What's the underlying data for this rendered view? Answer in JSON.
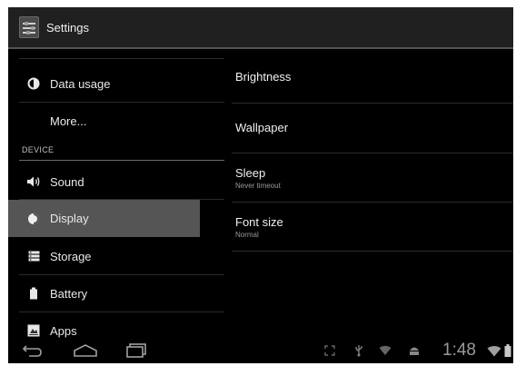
{
  "actionbar": {
    "title": "Settings",
    "icon": "settings-sliders-icon"
  },
  "left": {
    "items_top": [
      {
        "label": "Data usage",
        "icon": "data-usage-icon"
      },
      {
        "label": "More...",
        "icon": ""
      }
    ],
    "section_device": "DEVICE",
    "items_device": [
      {
        "label": "Sound",
        "icon": "speaker-icon"
      },
      {
        "label": "Display",
        "icon": "brightness-icon",
        "selected": true
      },
      {
        "label": "Storage",
        "icon": "storage-icon"
      },
      {
        "label": "Battery",
        "icon": "battery-icon"
      },
      {
        "label": "Apps",
        "icon": "apps-icon"
      }
    ]
  },
  "right": {
    "items": [
      {
        "title": "Brightness",
        "summary": ""
      },
      {
        "title": "Wallpaper",
        "summary": ""
      },
      {
        "title": "Sleep",
        "summary": "Never timeout"
      },
      {
        "title": "Font size",
        "summary": "Normal"
      }
    ]
  },
  "navbar": {
    "buttons": [
      "back-icon",
      "home-icon",
      "recent-apps-icon"
    ],
    "status_icons": [
      "fullscreen-icon",
      "usb-icon",
      "wifi-notification-icon",
      "android-debug-icon",
      "wifi-signal-icon",
      "battery-status-icon"
    ],
    "clock": "1:48"
  },
  "colors": {
    "selected_bg": "#555555",
    "actionbar_bg": "#202020",
    "background": "#000000"
  }
}
